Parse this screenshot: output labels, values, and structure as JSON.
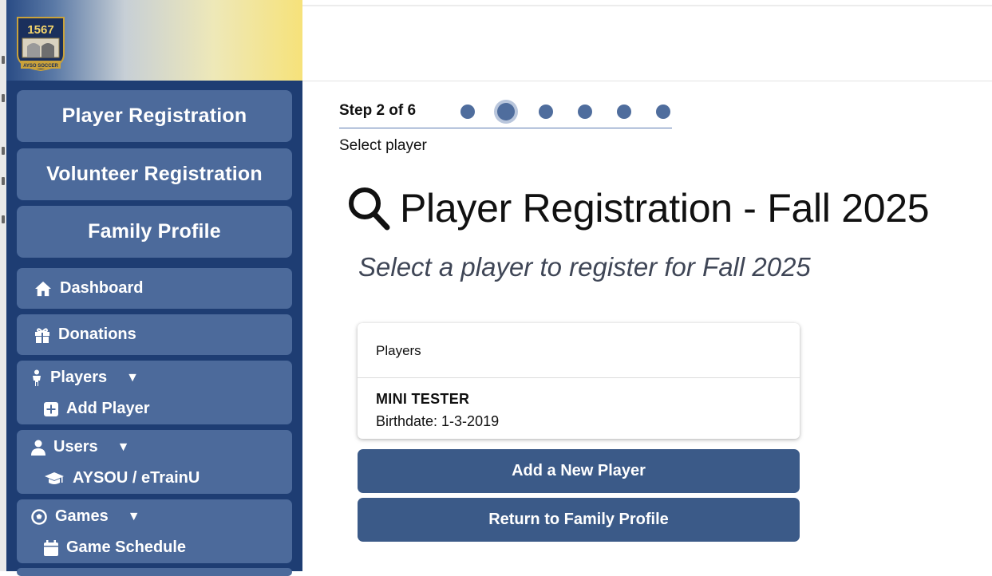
{
  "brand": {
    "logo_alt": "AYSO 1567 Los Feliz logo",
    "logo_number": "1567",
    "logo_footer": "AYSO SOCCER",
    "colors": {
      "sidebar": "#1e3d73",
      "button": "#4c6a9b",
      "action": "#3b5a88",
      "gold": "#f6e27a"
    }
  },
  "sidebar": {
    "main_buttons": [
      {
        "label": "Player Registration"
      },
      {
        "label": "Volunteer Registration"
      },
      {
        "label": "Family Profile"
      }
    ],
    "dashboard": {
      "label": "Dashboard",
      "icon": "home-icon"
    },
    "donations": {
      "label": "Donations",
      "icon": "gift-icon"
    },
    "players": {
      "label": "Players",
      "icon": "child-icon",
      "caret": "▼",
      "sub": {
        "label": "Add Player",
        "icon": "plus-square-icon"
      }
    },
    "users": {
      "label": "Users",
      "icon": "user-icon",
      "caret": "▼",
      "sub": {
        "label": "AYSOU / eTrainU",
        "icon": "graduation-cap-icon"
      }
    },
    "games": {
      "label": "Games",
      "icon": "soccer-ball-icon",
      "caret": "▼",
      "sub": {
        "label": "Game Schedule",
        "icon": "calendar-icon"
      }
    }
  },
  "stepper": {
    "label": "Step 2 of 6",
    "current": 2,
    "total": 6,
    "sublabel": "Select player"
  },
  "main": {
    "title": "Player Registration - Fall 2025",
    "subtitle": "Select a player to register for Fall 2025",
    "players_card": {
      "header": "Players",
      "players": [
        {
          "name": "MINI TESTER",
          "birthdate": "Birthdate: 1-3-2019"
        }
      ]
    },
    "buttons": {
      "add_player": "Add a New Player",
      "return_profile": "Return to Family Profile"
    }
  }
}
